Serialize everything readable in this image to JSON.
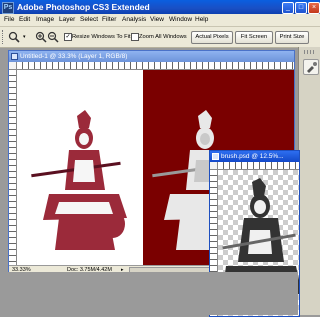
{
  "app": {
    "title": "Adobe Photoshop CS3 Extended",
    "icon_text": "Ps"
  },
  "window_controls": {
    "minimize": "_",
    "maximize": "□",
    "close": "×"
  },
  "menu": [
    "File",
    "Edit",
    "Image",
    "Layer",
    "Select",
    "Filter",
    "Analysis",
    "View",
    "Window",
    "Help"
  ],
  "options": {
    "resize_windows_to_fit": "Resize Windows To Fit",
    "resize_checked": true,
    "zoom_all_windows": "Zoom All Windows",
    "zoom_all_checked": false,
    "actual_pixels": "Actual Pixels",
    "fit_screen": "Fit Screen",
    "print_size": "Print Size"
  },
  "doc1": {
    "title": "Untitled-1 @ 33.3% (Layer 1, RGB/8)",
    "zoom": "33.33%",
    "doc_size": "Doc: 3.75M/4.42M",
    "bg_left": "#ffffff",
    "bg_right": "#7a0000"
  },
  "doc2": {
    "title": "brush.psd @ 12.5%..."
  },
  "colors": {
    "figure_red": "#9b2a3a",
    "figure_white": "#f2f2f2",
    "figure_gray": "#3a3a3a",
    "titlebar_active": "#1248c8"
  }
}
